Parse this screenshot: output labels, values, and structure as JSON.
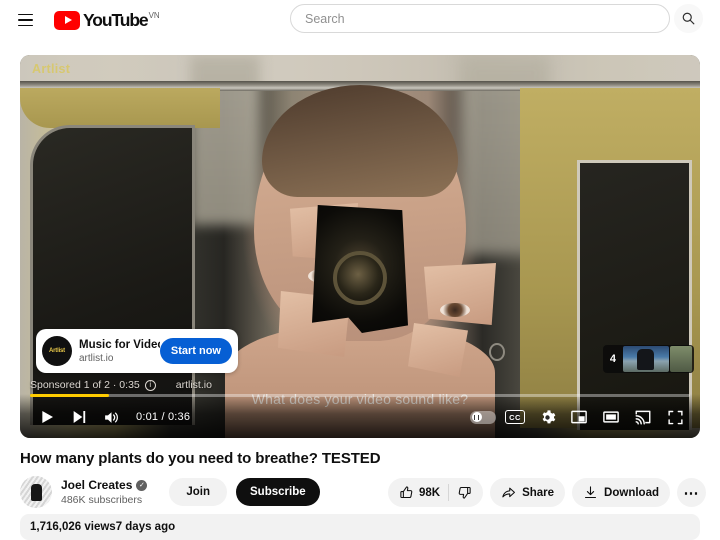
{
  "header": {
    "menu_icon": "hamburger-menu-icon",
    "logo_text": "YouTube",
    "country_code": "VN",
    "search": {
      "placeholder": "Search",
      "value": "",
      "button_icon": "search-icon"
    }
  },
  "player": {
    "watermark": "Artlist",
    "ad_caption": "What does your video sound like?",
    "ad_card": {
      "logo_text": "Artlist",
      "title": "Music for Video",
      "subtitle": "artlist.io",
      "cta_label": "Start now",
      "cta_color": "#065fd4"
    },
    "sponsor": {
      "label": "Sponsored 1 of 2 · 0:35",
      "info_icon": "info-icon",
      "advertiser": "artlist.io"
    },
    "queue": {
      "count": "4"
    },
    "controls": {
      "play_icon": "play-icon",
      "next_icon": "next-video-icon",
      "volume_icon": "volume-icon",
      "time": "0:01 / 0:36",
      "current_time": "0:01",
      "duration": "0:36",
      "autoplay_icon": "autoplay-toggle-icon",
      "captions_label": "CC",
      "settings_icon": "gear-icon",
      "miniplayer_icon": "miniplayer-icon",
      "theater_icon": "theater-mode-icon",
      "cast_icon": "cast-icon",
      "fullscreen_icon": "fullscreen-icon",
      "progress_percent": 12,
      "progress_color": "#ffcc00"
    }
  },
  "video": {
    "title": "How many plants do you need to breathe? TESTED",
    "channel": {
      "name": "Joel Creates",
      "verified_icon": "verified-badge-icon",
      "subscribers": "486K subscribers",
      "avatar_icon": "channel-avatar"
    },
    "join_label": "Join",
    "subscribe_label": "Subscribe",
    "actions": {
      "like_icon": "thumbs-up-icon",
      "like_count": "98K",
      "dislike_icon": "thumbs-down-icon",
      "share_icon": "share-icon",
      "share_label": "Share",
      "download_icon": "download-icon",
      "download_label": "Download",
      "more_label": "⋯"
    },
    "stats": {
      "views": "1,716,026 views",
      "published": "7 days ago"
    }
  }
}
